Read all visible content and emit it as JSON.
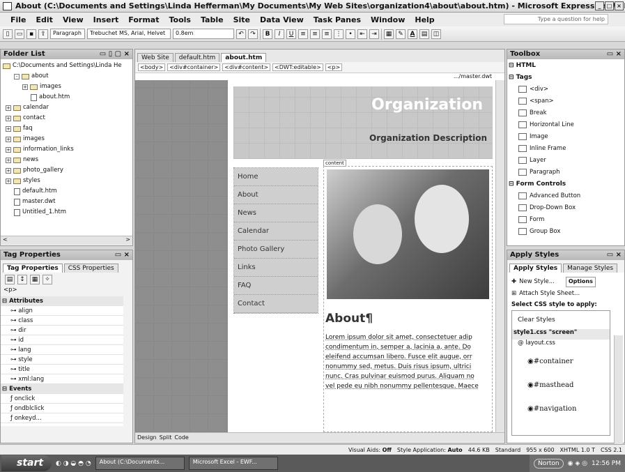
{
  "window": {
    "title": "About (C:\\Documents and Settings\\Linda Hefferman\\My Documents\\My Web Sites\\organization4\\about\\about.htm) - Microsoft Expression Web"
  },
  "menu": {
    "items": [
      "File",
      "Edit",
      "View",
      "Insert",
      "Format",
      "Tools",
      "Table",
      "Site",
      "Data View",
      "Task Panes",
      "Window",
      "Help"
    ],
    "help_placeholder": "Type a question for help"
  },
  "toolbar": {
    "style": "Paragraph",
    "font": "Trebuchet MS, Arial, Helvet",
    "size": "0.8em"
  },
  "folder_list": {
    "title": "Folder List",
    "root": "C:\\Documents and Settings\\Linda He",
    "items": [
      {
        "label": "about",
        "indent": 1,
        "kind": "folder",
        "exp": "-"
      },
      {
        "label": "images",
        "indent": 2,
        "kind": "folder",
        "exp": "+"
      },
      {
        "label": "about.htm",
        "indent": 3,
        "kind": "file",
        "exp": ""
      },
      {
        "label": "calendar",
        "indent": 0,
        "kind": "folder",
        "exp": "+"
      },
      {
        "label": "contact",
        "indent": 0,
        "kind": "folder",
        "exp": "+"
      },
      {
        "label": "faq",
        "indent": 0,
        "kind": "folder",
        "exp": "+"
      },
      {
        "label": "images",
        "indent": 0,
        "kind": "folder",
        "exp": "+"
      },
      {
        "label": "information_links",
        "indent": 0,
        "kind": "folder",
        "exp": "+"
      },
      {
        "label": "news",
        "indent": 0,
        "kind": "folder",
        "exp": "+"
      },
      {
        "label": "photo_gallery",
        "indent": 0,
        "kind": "folder",
        "exp": "+"
      },
      {
        "label": "styles",
        "indent": 0,
        "kind": "folder",
        "exp": "+"
      },
      {
        "label": "default.htm",
        "indent": 1,
        "kind": "file",
        "exp": ""
      },
      {
        "label": "master.dwt",
        "indent": 1,
        "kind": "file",
        "exp": ""
      },
      {
        "label": "Untitled_1.htm",
        "indent": 1,
        "kind": "file",
        "exp": ""
      }
    ]
  },
  "tag_props": {
    "title": "Tag Properties",
    "tabs": [
      "Tag Properties",
      "CSS Properties"
    ],
    "tag": "<p>",
    "attrs_label": "Attributes",
    "attrs": [
      "align",
      "class",
      "dir",
      "id",
      "lang",
      "style",
      "title",
      "xml:lang"
    ],
    "events_label": "Events",
    "events": [
      "onclick",
      "ondblclick",
      "onkeyd..."
    ]
  },
  "editor": {
    "tabs": [
      "Web Site",
      "default.htm",
      "about.htm"
    ],
    "crumbs": [
      "<body>",
      "<div#container>",
      "<div#content>",
      "<DWT:editable>",
      "<p>"
    ],
    "master": ".../master.dwt",
    "content_label": "content",
    "view_tabs": [
      "Design",
      "Split",
      "Code"
    ]
  },
  "page": {
    "site_title": "Organization",
    "description": "Organization Description",
    "nav": [
      "Home",
      "About",
      "News",
      "Calendar",
      "Photo Gallery",
      "Links",
      "FAQ",
      "Contact"
    ],
    "heading": "About¶",
    "body": [
      "Lorem ipsum dolor sit amet, consectetuer adip",
      "condimentum in, semper a, lacinia a, ante. Do",
      "eleifend accumsan libero. Fusce elit augue, orr",
      "nonummy sed, metus. Duis risus ipsum, ultrici",
      "nunc. Cras pulvinar euismod purus. Aliquam no",
      "vel pede eu nibh nonummy pellentesque. Maece"
    ]
  },
  "toolbox": {
    "title": "Toolbox",
    "html": "HTML",
    "tags_label": "Tags",
    "tags": [
      "<div>",
      "<span>",
      "Break",
      "Horizontal Line",
      "Image",
      "Inline Frame",
      "Layer",
      "Paragraph"
    ],
    "forms_label": "Form Controls",
    "forms": [
      "Advanced Button",
      "Drop-Down Box",
      "Form",
      "Group Box"
    ]
  },
  "apply_styles": {
    "title": "Apply Styles",
    "tabs": [
      "Apply Styles",
      "Manage Styles"
    ],
    "new_style": "New Style...",
    "options": "Options",
    "attach": "Attach Style Sheet...",
    "select_label": "Select CSS style to apply:",
    "clear": "Clear Styles",
    "sheet": "style1.css \"screen\"",
    "import": "@ layout.css",
    "rules": [
      "#container",
      "#masthead",
      "#navigation"
    ]
  },
  "status": {
    "visual_aids": "Visual Aids:",
    "va_val": "Off",
    "style_app": "Style Application:",
    "sa_val": "Auto",
    "size": "44.6 KB",
    "standard": "Standard",
    "dims": "955 x 600",
    "doctype": "XHTML 1.0 T",
    "css": "CSS 2.1"
  },
  "taskbar": {
    "start": "start",
    "tasks": [
      "About (C:\\Documents...",
      "Microsoft Excel - EWF..."
    ],
    "norton": "Norton",
    "time": "12:56 PM"
  }
}
